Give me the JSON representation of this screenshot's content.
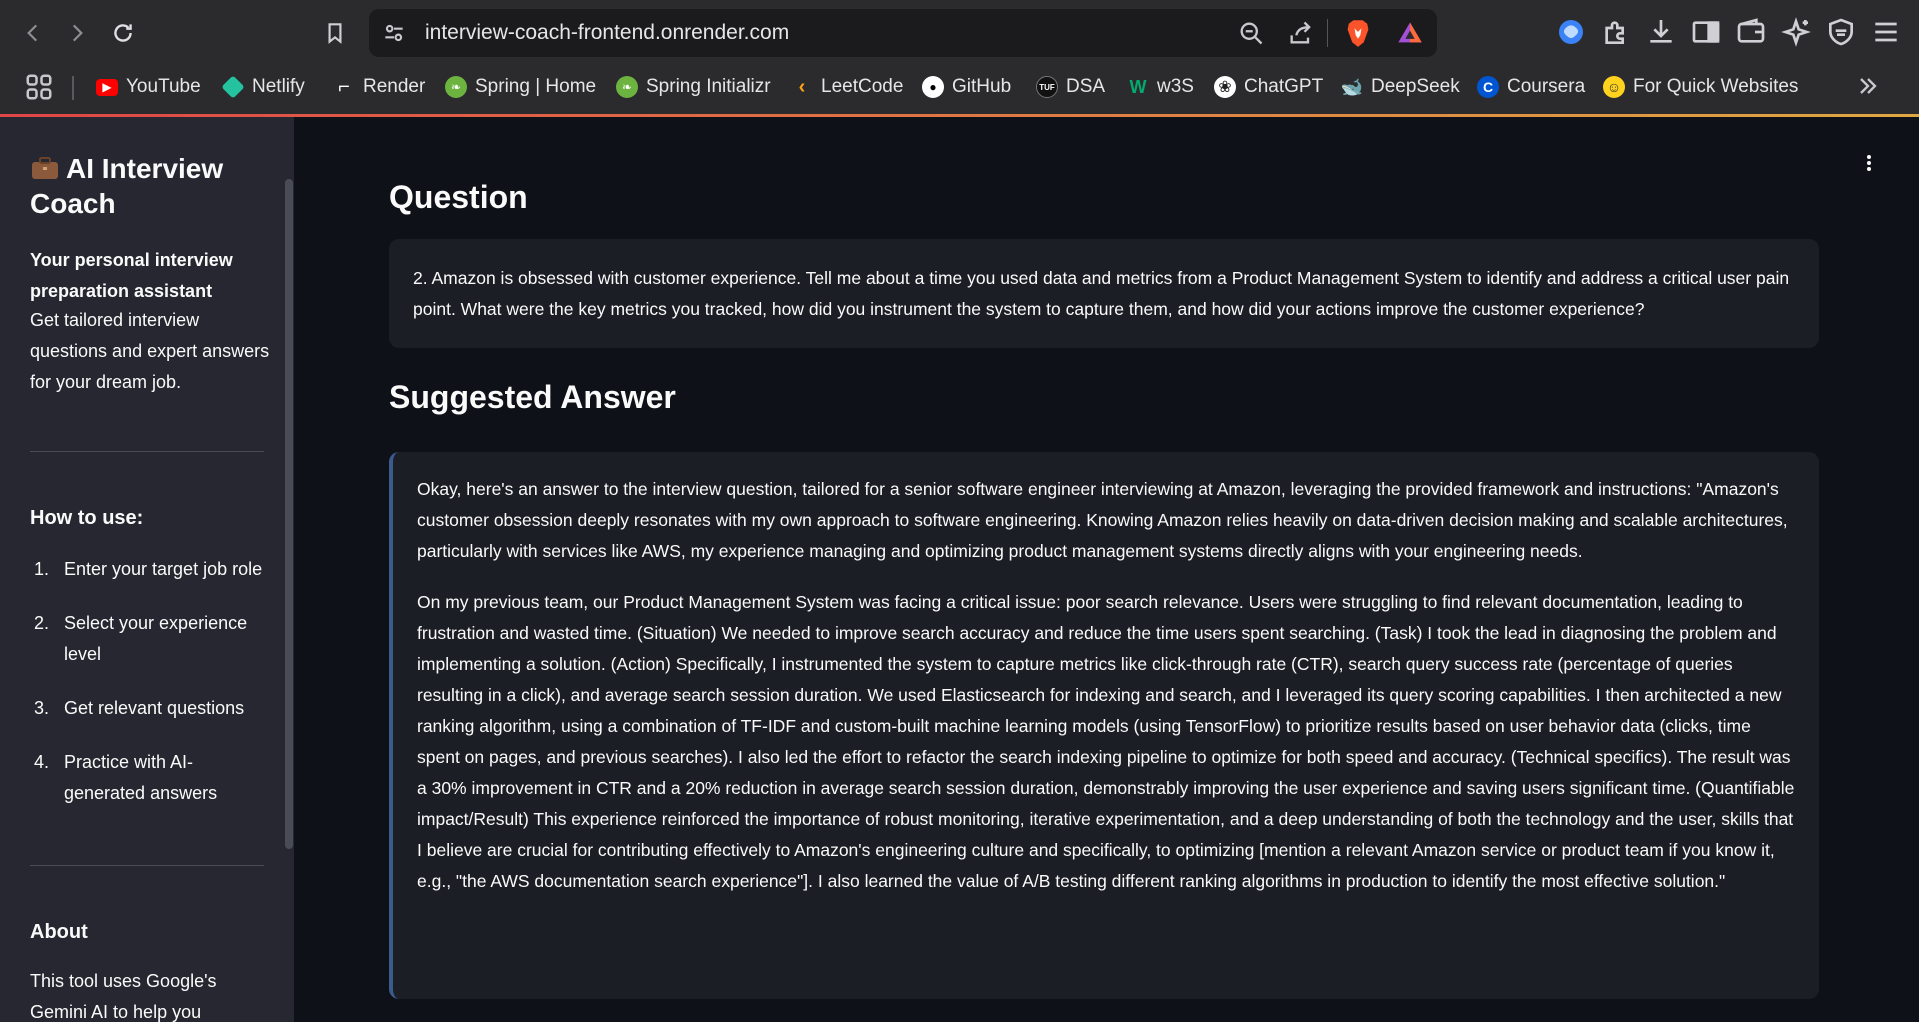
{
  "browser": {
    "url": "interview-coach-frontend.onrender.com",
    "bookmarks": [
      {
        "label": "YouTube",
        "icon": "youtube-icon",
        "color": "#ff0000"
      },
      {
        "label": "Netlify",
        "icon": "netlify-icon",
        "color": "#25c2a0"
      },
      {
        "label": "Render",
        "icon": "render-icon",
        "color": "#ffffff"
      },
      {
        "label": "Spring | Home",
        "icon": "spring-icon",
        "color": "#6db33f"
      },
      {
        "label": "Spring Initializr",
        "icon": "spring-icon",
        "color": "#6db33f"
      },
      {
        "label": "LeetCode",
        "icon": "leetcode-icon",
        "color": "#ffa116"
      },
      {
        "label": "GitHub",
        "icon": "github-icon",
        "color": "#ffffff"
      },
      {
        "label": "DSA",
        "icon": "tuf-icon",
        "color": "#111111"
      },
      {
        "label": "w3S",
        "icon": "w3schools-icon",
        "color": "#04aa6d"
      },
      {
        "label": "ChatGPT",
        "icon": "chatgpt-icon",
        "color": "#ffffff"
      },
      {
        "label": "DeepSeek",
        "icon": "deepseek-icon",
        "color": "#4d6bfe"
      },
      {
        "label": "Coursera",
        "icon": "coursera-icon",
        "color": "#0056d2"
      },
      {
        "label": "For Quick Websites",
        "icon": "huggingface-icon",
        "color": "#ffd21e"
      }
    ]
  },
  "sidebar": {
    "icon": "briefcase-icon",
    "title": "AI Interview Coach",
    "tagline": "Your personal interview preparation assistant",
    "description": "Get tailored interview questions and expert answers for your dream job.",
    "how_to_heading": "How to use:",
    "steps": [
      {
        "num": "1.",
        "text": "Enter your target job role"
      },
      {
        "num": "2.",
        "text": "Select your experience level"
      },
      {
        "num": "3.",
        "text": "Get relevant questions"
      },
      {
        "num": "4.",
        "text": "Practice with AI-generated answers"
      }
    ],
    "about_heading": "About",
    "about_text": "This tool uses Google's Gemini AI to help you"
  },
  "main": {
    "question_heading": "Question",
    "question_text": "2. Amazon is obsessed with customer experience. Tell me about a time you used data and metrics from a Product Management System to identify and address a critical user pain point. What were the key metrics you tracked, how did you instrument the system to capture them, and how did your actions improve the customer experience?",
    "answer_heading": "Suggested Answer",
    "answer_p1": "Okay, here's an answer to the interview question, tailored for a senior software engineer interviewing at Amazon, leveraging the provided framework and instructions: \"Amazon's customer obsession deeply resonates with my own approach to software engineering. Knowing Amazon relies heavily on data-driven decision making and scalable architectures, particularly with services like AWS, my experience managing and optimizing product management systems directly aligns with your engineering needs.",
    "answer_p2": "On my previous team, our Product Management System was facing a critical issue: poor search relevance. Users were struggling to find relevant documentation, leading to frustration and wasted time. (Situation) We needed to improve search accuracy and reduce the time users spent searching. (Task) I took the lead in diagnosing the problem and implementing a solution. (Action) Specifically, I instrumented the system to capture metrics like click-through rate (CTR), search query success rate (percentage of queries resulting in a click), and average search session duration. We used Elasticsearch for indexing and search, and I leveraged its query scoring capabilities. I then architected a new ranking algorithm, using a combination of TF-IDF and custom-built machine learning models (using TensorFlow) to prioritize results based on user behavior data (clicks, time spent on pages, and previous searches). I also led the effort to refactor the search indexing pipeline to optimize for both speed and accuracy. (Technical specifics). The result was a 30% improvement in CTR and a 20% reduction in average search session duration, demonstrably improving the user experience and saving users significant time. (Quantifiable impact/Result) This experience reinforced the importance of robust monitoring, iterative experimentation, and a deep understanding of both the technology and the user, skills that I believe are crucial for contributing effectively to Amazon's engineering culture and specifically, to optimizing [mention a relevant Amazon service or product team if you know it, e.g., \"the AWS documentation search experience\"]. I also learned the value of A/B testing different ranking algorithms in production to identify the most effective solution.\""
  }
}
